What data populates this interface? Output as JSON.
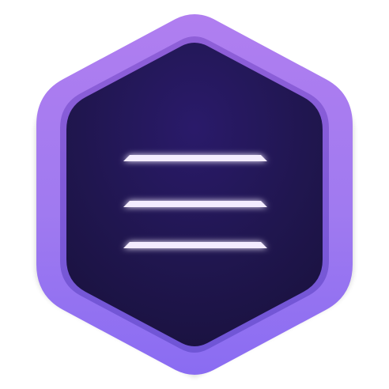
{
  "icon": {
    "name": "hamburger-menu-hexagon-app-icon",
    "glyph": "three-horizontal-lines",
    "colors": {
      "background": "#ffffff",
      "outer_frame_top": "#b07ef0",
      "outer_frame_bottom": "#8a6cf2",
      "frame_edge": "#7c5ad8",
      "inner_panel_top": "#2a1a6a",
      "inner_panel_bottom": "#1a1240",
      "lines": "#f3ecff",
      "line_glow": "#c9b8ff"
    }
  }
}
